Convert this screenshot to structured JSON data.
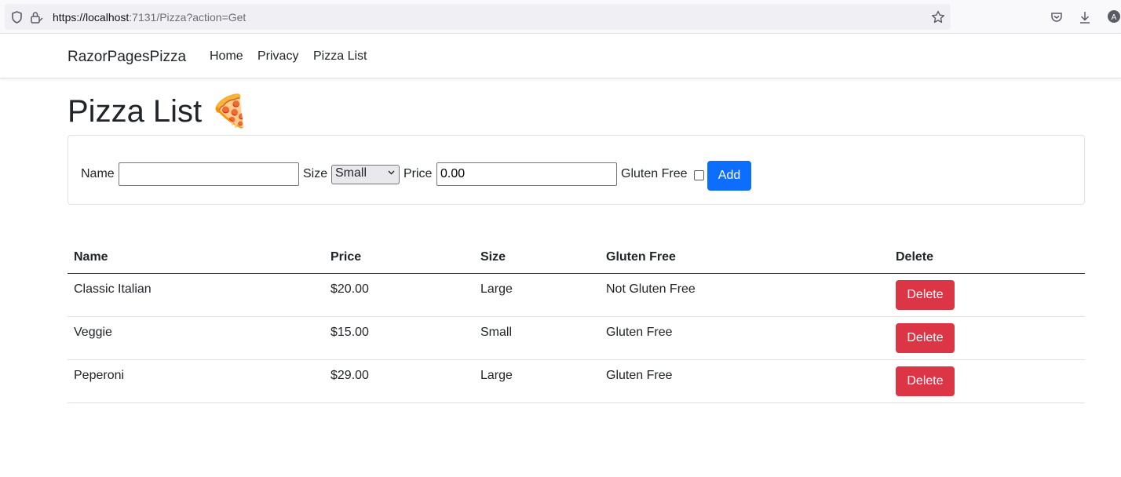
{
  "browser": {
    "url_host": "https://localhost",
    "url_rest": ":7131/Pizza?action=Get"
  },
  "navbar": {
    "brand": "RazorPagesPizza",
    "links": [
      "Home",
      "Privacy",
      "Pizza List"
    ]
  },
  "page": {
    "title": "Pizza List 🍕"
  },
  "form": {
    "name_label": "Name",
    "name_value": "",
    "size_label": "Size",
    "size_selected": "Small",
    "price_label": "Price",
    "price_value": "0.00",
    "gluten_label": "Gluten Free",
    "gluten_checked": false,
    "add_label": "Add"
  },
  "table": {
    "headers": [
      "Name",
      "Price",
      "Size",
      "Gluten Free",
      "Delete"
    ],
    "rows": [
      {
        "name": "Classic Italian",
        "price": "$20.00",
        "size": "Large",
        "gluten": "Not Gluten Free",
        "delete": "Delete"
      },
      {
        "name": "Veggie",
        "price": "$15.00",
        "size": "Small",
        "gluten": "Gluten Free",
        "delete": "Delete"
      },
      {
        "name": "Peperoni",
        "price": "$29.00",
        "size": "Large",
        "gluten": "Gluten Free",
        "delete": "Delete"
      }
    ]
  },
  "colors": {
    "primary": "#0d6efd",
    "danger": "#dc3545"
  }
}
